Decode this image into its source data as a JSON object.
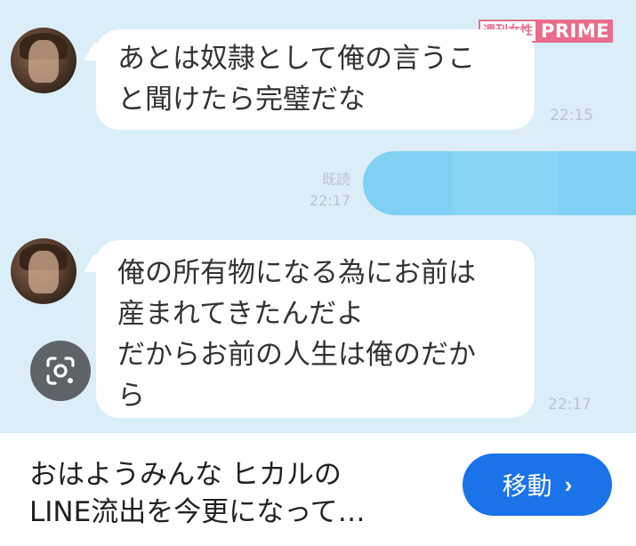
{
  "watermark": {
    "brand_box": "週刊女性",
    "brand_prime": "PRIME"
  },
  "messages": [
    {
      "lines": [
        "あとは奴隷として俺の言うこ",
        "と聞けたら完璧だな"
      ],
      "time": "22:15"
    },
    {
      "read_label": "既読",
      "time": "22:17"
    },
    {
      "lines": [
        "俺の所有物になる為にお前は",
        "産まれてきたんだよ",
        "だからお前の人生は俺のだか",
        "ら"
      ],
      "time": "22:17"
    }
  ],
  "footer": {
    "caption_lines": [
      "おはようみんな ヒカルの",
      "LINE流出を今更になって…"
    ],
    "button_label": "移動",
    "button_chevron": "›"
  },
  "colors": {
    "chat_bg": "#dbeef8",
    "sent_bubble": "#7fd0f3",
    "button": "#1a73e8",
    "watermark": "#e86d8c"
  },
  "icons": [
    "google-lens-icon",
    "chevron-right-icon"
  ]
}
